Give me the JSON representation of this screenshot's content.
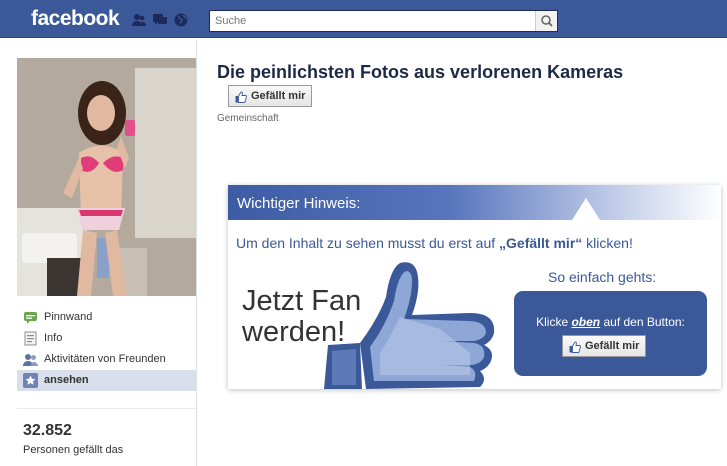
{
  "topbar": {
    "logo": "facebook",
    "search_placeholder": "Suche"
  },
  "sidebar": {
    "items": [
      {
        "label": "Pinnwand",
        "icon": "wall-icon"
      },
      {
        "label": "Info",
        "icon": "info-icon"
      },
      {
        "label": "Aktivitäten von Freunden",
        "icon": "friends-activity-icon"
      },
      {
        "label": "ansehen",
        "icon": "star-icon"
      }
    ],
    "likes_count": "32.852",
    "likes_label": "Personen gefällt das"
  },
  "page": {
    "title": "Die peinlichsten Fotos aus verlorenen Kameras",
    "like_label": "Gefällt mir",
    "category": "Gemeinschaft"
  },
  "promo": {
    "header": "Wichtiger Hinweis:",
    "subtitle_before": "Um den Inhalt zu sehen musst du erst auf ",
    "subtitle_bold": "„Gefällt mir“",
    "subtitle_after": " klicken!",
    "fan_line1": "Jetzt Fan",
    "fan_line2": "werden!",
    "howto": "So einfach gehts:",
    "box_before": "Klicke ",
    "box_emph": "oben",
    "box_after": " auf den Button:",
    "box_button": "Gefällt mir"
  },
  "colors": {
    "brand": "#3b5998",
    "title": "#1c2a47"
  }
}
